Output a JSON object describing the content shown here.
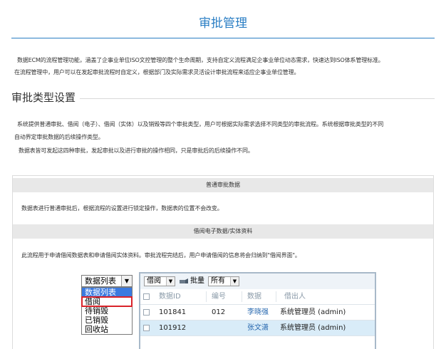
{
  "page": {
    "title": "审批管理",
    "intro_line1": "数据ECM的流程管理功能，涵盖了企事业单位ISO文控管理的整个生命周期，支持自定义流程满足企事业单位动态需求，快速达到ISO体系管理标准。",
    "intro_line2": "在流程管理中，用户可以在发起审批流程时自定义，根据部门及实际需求灵活设计审批流程来适应企事业单位管理。"
  },
  "section": {
    "heading": "审批类型设置",
    "desc_line1": "系统提供普通审批、借阅（电子）、借阅（实体）以及销毁等四个审批类型，用户可根据实际需求选择不同类型的审批流程。系统根据审批类型的不同",
    "desc_line2": "自动界定审批数据的后续操作类型。",
    "desc_line3": "数据表皆可发起这四种审批，发起审批以及进行审批的操作相同，只是审批后的后续操作不同。"
  },
  "box": {
    "normal_header": "普通审批数据",
    "normal_text": "数据表进行普通审批后，根据流程的设置进行锁定操作，数据表的位置不会改变。",
    "borrow_header": "借阅电子数据/实体资料",
    "borrow_text": "此流程用于申请借阅数据表和申请借阅实体资料。审批流程完结后，用户申请借阅的信息将会归纳到\"借阅界面\"。"
  },
  "screenshot": {
    "dropdown": {
      "selected": "数据列表",
      "options": [
        "数据列表",
        "借阅",
        "待销毁",
        "已销毁",
        "回收站"
      ],
      "highlighted_index": 0,
      "boxed_index": 1
    },
    "toolbar": {
      "filter_value": "借阅",
      "batch_label": "批量",
      "batch_value": "所有"
    },
    "columns": [
      "数据ID",
      "编号",
      "数据",
      "借出人"
    ],
    "rows": [
      {
        "id": "101841",
        "code": "012",
        "data": "李晓强",
        "borrower": "系统管理员 (admin)"
      },
      {
        "id": "101912",
        "code": "",
        "data": "张文潇",
        "borrower": "系统管理员 (admin)"
      }
    ],
    "colors": {
      "accent": "#2a7ec4",
      "selection": "#3b7ae0",
      "highlight_box": "#d9232a",
      "alt_row": "#d9ecf8"
    }
  }
}
